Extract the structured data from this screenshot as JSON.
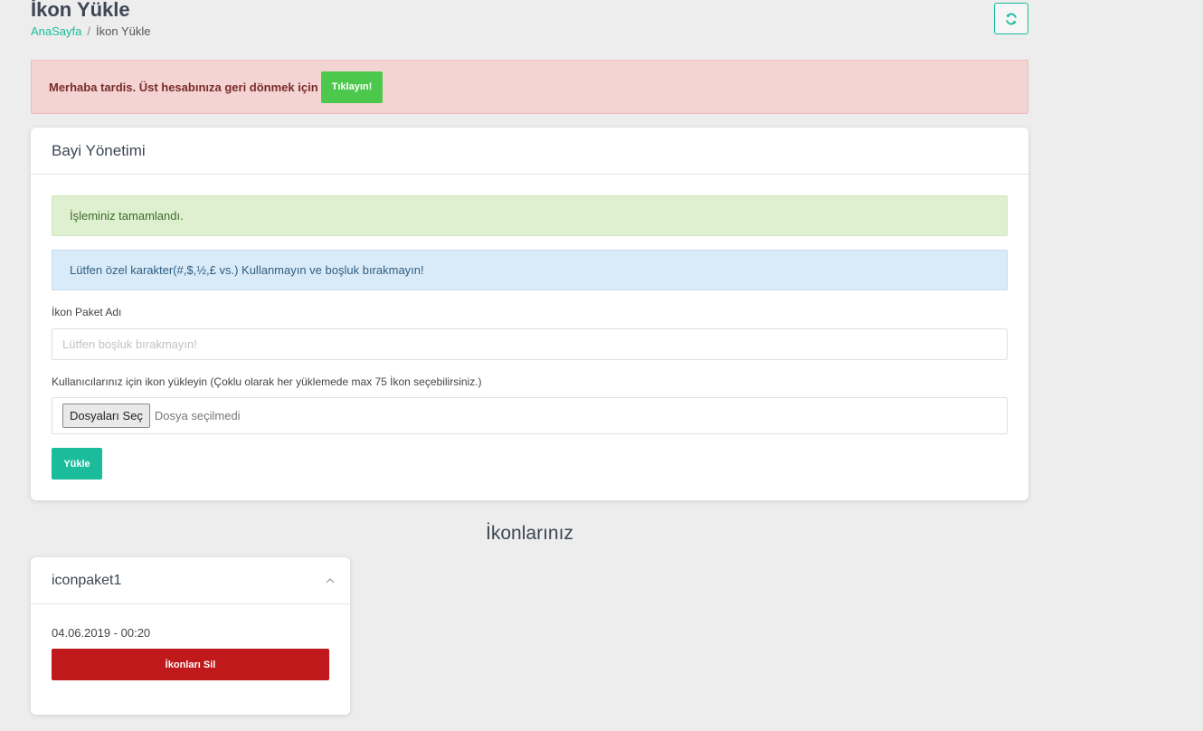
{
  "header": {
    "title": "İkon Yükle",
    "breadcrumb": {
      "home": "AnaSayfa",
      "separator": "/",
      "current": "İkon Yükle"
    },
    "refresh_icon": "refresh-icon"
  },
  "impersonation_alert": {
    "message": "Merhaba tardis. Üst hesabınıza geri dönmek için",
    "button_label": "Tıklayın!"
  },
  "panel": {
    "title": "Bayi Yönetimi",
    "success_message": "İşleminiz tamamlandı.",
    "info_message": "Lütfen özel karakter(#,$,½,£ vs.) Kullanmayın ve boşluk bırakmayın!",
    "package_name_label": "İkon Paket Adı",
    "package_name_placeholder": "Lütfen boşluk bırakmayın!",
    "package_name_value": "",
    "upload_label": "Kullanıcılarınız için ikon yükleyin (Çoklu olarak her yüklemede max 75 İkon seçebilirsiniz.)",
    "file_button_label": "Dosyaları Seç",
    "file_status": "Dosya seçilmedi",
    "submit_label": "Yükle"
  },
  "icons_section": {
    "title": "İkonlarınız",
    "packages": [
      {
        "name": "iconpaket1",
        "date": "04.06.2019 - 00:20",
        "delete_label": "İkonları Sil",
        "collapse_icon": "chevron-up-icon"
      }
    ]
  },
  "colors": {
    "accent": "#1abc9c",
    "danger": "#c0191b",
    "success_button": "#4cc94c",
    "background": "#ededed"
  }
}
